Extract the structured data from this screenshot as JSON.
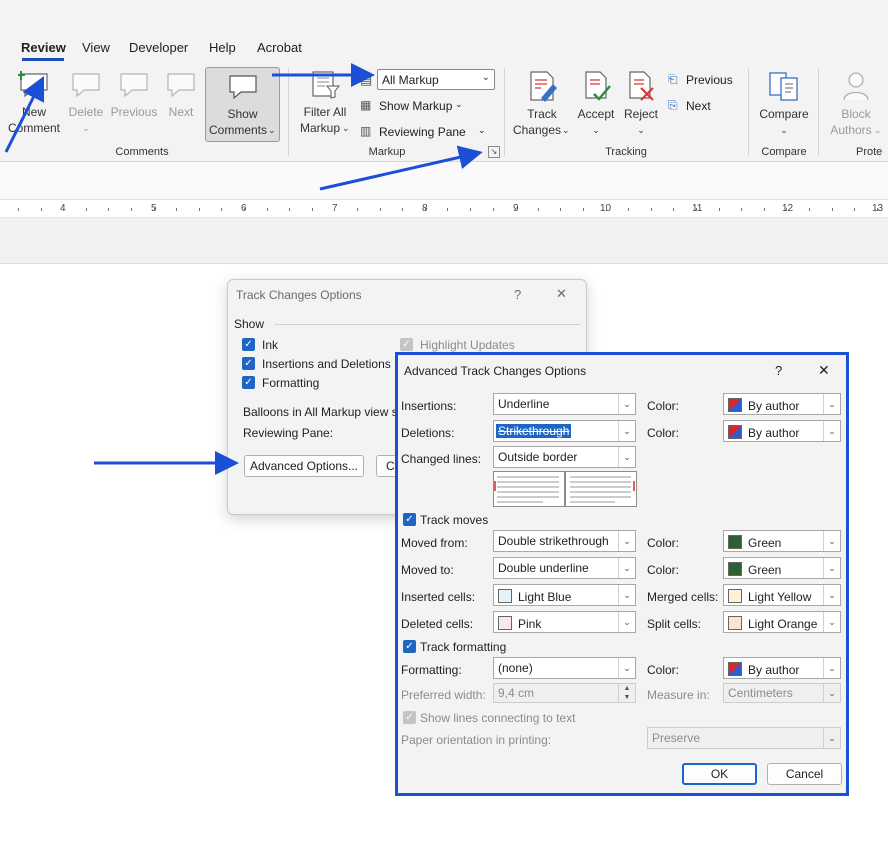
{
  "ribbon": {
    "tabs": [
      "Review",
      "View",
      "Developer",
      "Help",
      "Acrobat"
    ],
    "comments": {
      "new_comment_line1": "New",
      "new_comment_line2": "Comment",
      "delete": "Delete",
      "previous": "Previous",
      "next": "Next",
      "show_comments_line1": "Show",
      "show_comments_line2": "Comments",
      "group_label": "Comments"
    },
    "markup": {
      "filter_line1": "Filter All",
      "filter_line2": "Markup",
      "display_select": "All Markup",
      "show_markup": "Show Markup",
      "reviewing_pane": "Reviewing Pane",
      "group_label": "Markup"
    },
    "tracking": {
      "track_line1": "Track",
      "track_line2": "Changes",
      "accept": "Accept",
      "reject": "Reject",
      "previous": "Previous",
      "next": "Next",
      "group_label": "Tracking"
    },
    "compare": {
      "label": "Compare",
      "group_label": "Compare"
    },
    "protect": {
      "block_line1": "Block",
      "block_line2": "Authors",
      "group_label": "Prote"
    }
  },
  "ruler": {
    "numbers": [
      "4",
      "5",
      "6",
      "7",
      "8",
      "9",
      "10",
      "11",
      "12",
      "13"
    ]
  },
  "track_changes_options": {
    "title": "Track Changes Options",
    "help": "?",
    "close": "✕",
    "show_label": "Show",
    "ink": "Ink",
    "insertions_deletions": "Insertions and Deletions",
    "formatting": "Formatting",
    "highlight_updates": "Highlight Updates",
    "balloons": "Balloons in All Markup view s",
    "reviewing_pane": "Reviewing Pane:",
    "advanced_button": "Advanced Options...",
    "change_button_partial": "Ch"
  },
  "advanced": {
    "title": "Advanced Track Changes Options",
    "help": "?",
    "close": "✕",
    "insertions_label": "Insertions:",
    "insertions_value": "Underline",
    "deletions_label": "Deletions:",
    "deletions_value": "Strikethrough",
    "changed_lines_label": "Changed lines:",
    "changed_lines_value": "Outside border",
    "color_label": "Color:",
    "by_author": "By author",
    "track_moves": "Track moves",
    "moved_from_label": "Moved from:",
    "moved_from_value": "Double strikethrough",
    "moved_to_label": "Moved to:",
    "moved_to_value": "Double underline",
    "green": "Green",
    "inserted_cells_label": "Inserted cells:",
    "inserted_cells_value": "Light Blue",
    "merged_cells_label": "Merged cells:",
    "merged_cells_value": "Light Yellow",
    "deleted_cells_label": "Deleted cells:",
    "deleted_cells_value": "Pink",
    "split_cells_label": "Split cells:",
    "split_cells_value": "Light Orange",
    "track_formatting": "Track formatting",
    "formatting_label": "Formatting:",
    "formatting_value": "(none)",
    "preferred_width_label": "Preferred width:",
    "preferred_width_value": "9,4 cm",
    "measure_in_label": "Measure in:",
    "measure_in_value": "Centimeters",
    "show_lines": "Show lines connecting to text",
    "paper_orientation_label": "Paper orientation in printing:",
    "paper_orientation_value": "Preserve",
    "ok": "OK",
    "cancel": "Cancel"
  },
  "colors": {
    "accent": "#1f66c4",
    "highlight_border": "#1a4fd6",
    "annotation_arrow": "#1a4fd6",
    "green_swatch": "#2f5e36",
    "light_blue_swatch": "#e6f3fb",
    "light_yellow_swatch": "#fff1d6",
    "pink_swatch": "#fbe6ee",
    "light_orange_swatch": "#fde2cf"
  }
}
